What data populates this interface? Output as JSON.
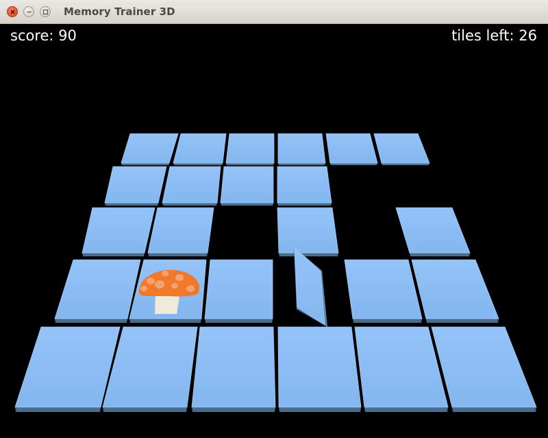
{
  "window": {
    "title": "Memory Trainer 3D"
  },
  "hud": {
    "score": "score: 90",
    "tiles_left": "tiles left: 26"
  },
  "colors": {
    "tile_face": "#8dbef5",
    "tile_edge": "#4b6d8c",
    "background": "#000000",
    "mushroom_cap": "#f07a2a",
    "mushroom_spots": "#f4a273",
    "mushroom_stem": "#f0ead8"
  },
  "board": {
    "revealed_tile": {
      "row": 4,
      "col": 2,
      "symbol": "mushroom-icon"
    },
    "flipping_tile": {
      "row": 4,
      "col": 4
    }
  }
}
